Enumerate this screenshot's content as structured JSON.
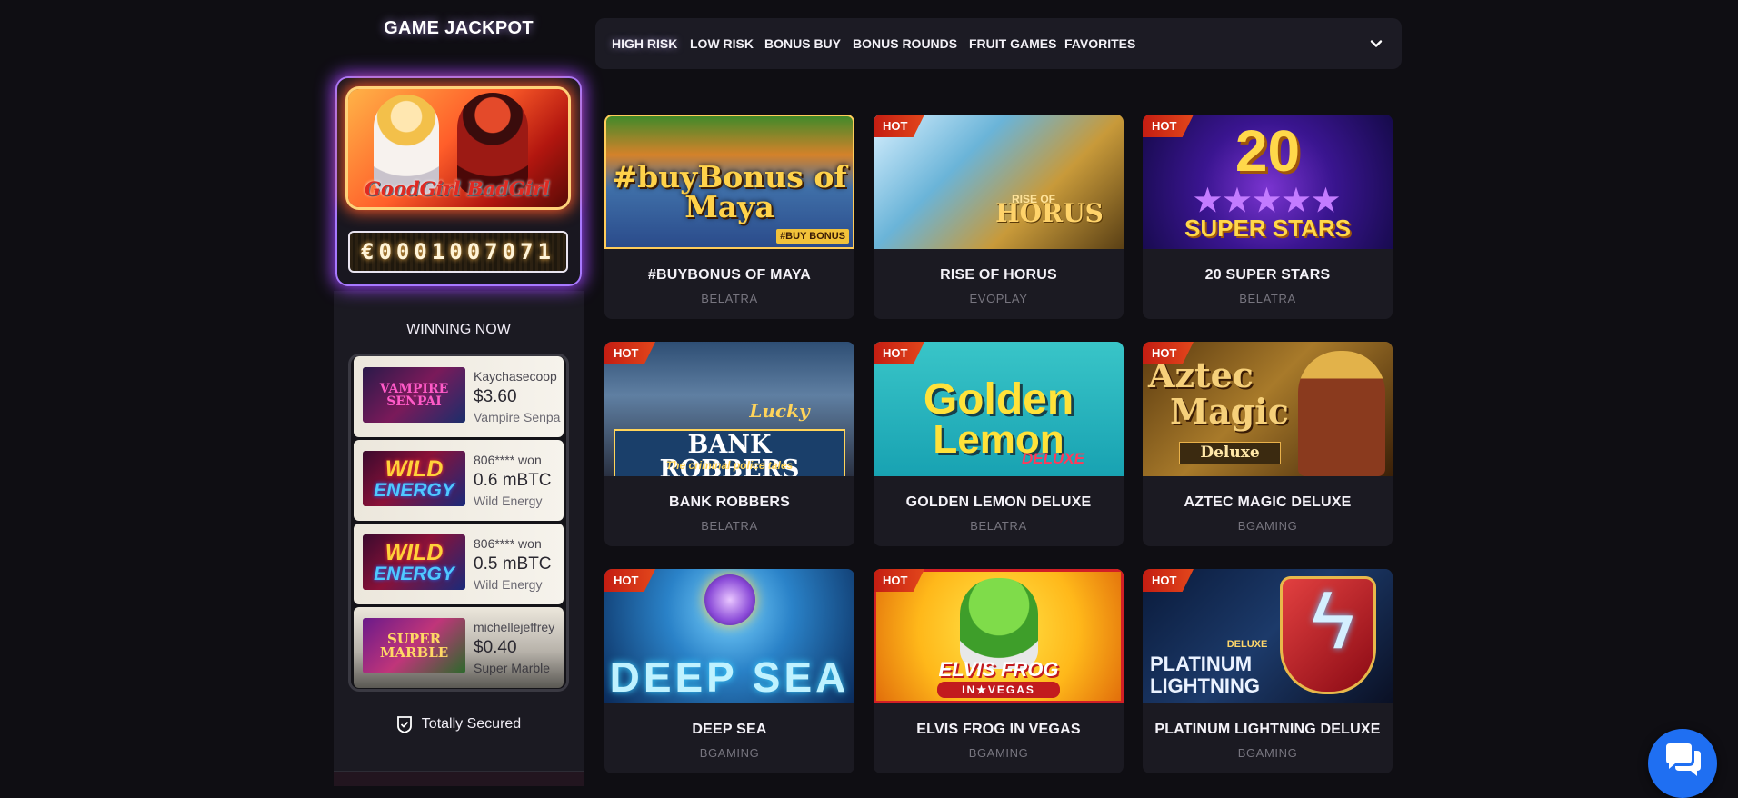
{
  "sidebar": {
    "jackpot_title": "GAME JACKPOT",
    "jackpot_game_logo": "GoodGirl BadGirl",
    "jackpot_amount": "€0001007071",
    "winning_title": "WINNING NOW",
    "winners": [
      {
        "user": "Kaychasecoop",
        "amount": "$3.60",
        "game": "Vampire Senpai",
        "thumb_text": "VAMPIRE SENPAI"
      },
      {
        "user": "806**** won",
        "amount": "0.6 mBTC",
        "game": "Wild Energy",
        "thumb_text": "WILD",
        "thumb_text2": "ENERGY"
      },
      {
        "user": "806**** won",
        "amount": "0.5 mBTC",
        "game": "Wild Energy",
        "thumb_text": "WILD",
        "thumb_text2": "ENERGY"
      },
      {
        "user": "michellejeffrey",
        "amount": "$0.40",
        "game": "Super Marble",
        "thumb_text": "SUPER MARBLE"
      }
    ],
    "secured_label": "Totally Secured"
  },
  "tabs": [
    {
      "label": "HIGH RISK",
      "active": true
    },
    {
      "label": "LOW RISK"
    },
    {
      "label": "BONUS BUY"
    },
    {
      "label": "BONUS ROUNDS"
    },
    {
      "label": "FRUIT GAMES"
    },
    {
      "label": "FAVORITES"
    }
  ],
  "hot_label": "HOT",
  "games": [
    {
      "title": "#BUYBONUS OF MAYA",
      "provider": "BELATRA",
      "hot": false,
      "art_text": "#buyBonus of Maya",
      "art_tag": "#BUY BONUS"
    },
    {
      "title": "RISE OF HORUS",
      "provider": "EVOPLAY",
      "hot": true,
      "art_small": "RISE OF",
      "art_text": "HORUS"
    },
    {
      "title": "20 SUPER STARS",
      "provider": "BELATRA",
      "hot": true,
      "art_num": "20",
      "art_stars": "★★★★★",
      "art_text": "SUPER STARS"
    },
    {
      "title": "BANK ROBBERS",
      "provider": "BELATRA",
      "hot": true,
      "art_lucky": "Lucky",
      "art_text": "BANK ROBBERS",
      "art_sub": "The criminal police tales"
    },
    {
      "title": "GOLDEN LEMON DELUXE",
      "provider": "BELATRA",
      "hot": true,
      "art_l1": "Golden",
      "art_l2": "Lemon",
      "art_dlx": "DELUXE"
    },
    {
      "title": "AZTEC MAGIC DELUXE",
      "provider": "BGAMING",
      "hot": true,
      "art_l1": "Aztec",
      "art_l2": "Magic",
      "art_dlx": "Deluxe"
    },
    {
      "title": "DEEP SEA",
      "provider": "BGAMING",
      "hot": true,
      "art_text": "DEEP SEA"
    },
    {
      "title": "ELVIS FROG IN VEGAS",
      "provider": "BGAMING",
      "hot": true,
      "art_text": "ELVIS FROG",
      "art_sub": "IN★VEGAS"
    },
    {
      "title": "PLATINUM LIGHTNING DELUXE",
      "provider": "BGAMING",
      "hot": true,
      "art_dlx": "DELUXE",
      "art_l1": "PLATINUM",
      "art_l2": "LIGHTNING"
    }
  ],
  "icons": {
    "shield": "shield-check-icon",
    "chevron": "chevron-down-icon",
    "chat": "chat-bubbles-icon"
  },
  "colors": {
    "page_bg": "#0f0e13",
    "card_bg": "#1b1a22",
    "hot_badge": "#d7341a",
    "jackpot_glow": "#a046ff",
    "chat_button": "#1f6ff2"
  }
}
